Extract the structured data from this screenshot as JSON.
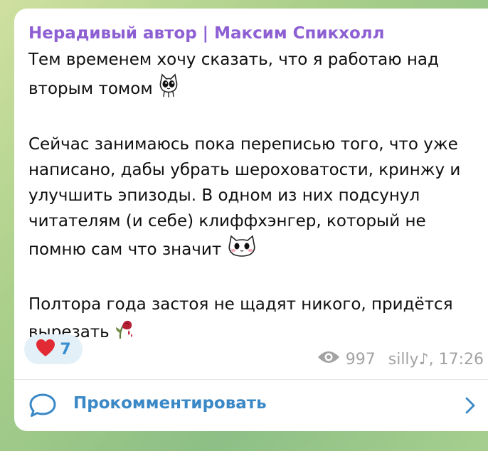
{
  "message": {
    "author": "Нерадивый автор | Максим Спикхолл",
    "paragraphs": [
      [
        "Тем временем хочу сказать, что я работаю над",
        "вторым томом"
      ],
      [
        "Сейчас занимаюсь пока переписью того, что уже",
        "написано, дабы убрать шероховатости, кринжу и",
        "улучшить эпизоды. В одном из них подсунул",
        "читателям (и себе) клиффхэнгер, который не",
        "помню сам что значит"
      ],
      [
        "Полтора года застоя не щадят никого, придётся",
        "вырезать"
      ]
    ],
    "emojis": [
      "cat-sticker-icon",
      "cat-sticker-icon",
      "wilted-rose-icon"
    ]
  },
  "reaction": {
    "emoji": "heart-icon",
    "count": "7"
  },
  "meta": {
    "views": "997",
    "signature": "silly♪, 17:26"
  },
  "comments": {
    "label": "Прокомментировать"
  },
  "colors": {
    "author": "#8d5fd3",
    "link": "#3a88c6",
    "reaction_bg": "#e3f0f8",
    "heart": "#e22a34",
    "meta": "#a3a3a3"
  }
}
